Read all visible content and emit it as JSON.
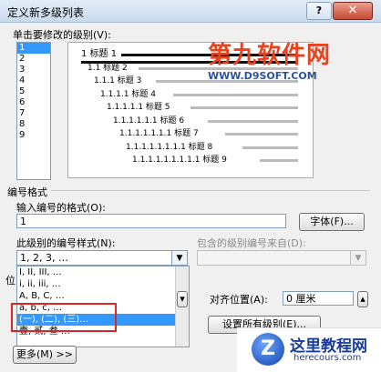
{
  "window": {
    "title": "定义新多级列表",
    "close_glyph": "✕",
    "help_glyph": "?"
  },
  "level_section": {
    "label": "单击要修改的级别(V):",
    "levels": [
      "1",
      "2",
      "3",
      "4",
      "5",
      "6",
      "7",
      "8",
      "9"
    ],
    "selected_index": 0
  },
  "preview": {
    "rows": [
      {
        "num": "1",
        "text": "标题 1"
      },
      {
        "num": "1.1",
        "text": "标题 2"
      },
      {
        "num": "1.1.1",
        "text": "标题 3"
      },
      {
        "num": "1.1.1.1",
        "text": "标题 4"
      },
      {
        "num": "1.1.1.1.1",
        "text": "标题 5"
      },
      {
        "num": "1.1.1.1.1.1",
        "text": "标题 6"
      },
      {
        "num": "1.1.1.1.1.1.1",
        "text": "标题 7"
      },
      {
        "num": "1.1.1.1.1.1.1.1",
        "text": "标题 8"
      },
      {
        "num": "1.1.1.1.1.1.1.1.1",
        "text": "标题 9"
      }
    ]
  },
  "number_format": {
    "section_label": "编号格式",
    "input_label": "输入编号的格式(O):",
    "input_value": "1",
    "font_button": "字体(F)...",
    "style_label": "此级别的编号样式(N):",
    "style_value": "1, 2, 3, …",
    "include_label": "包含的级别编号来自(D):",
    "style_options": [
      "I, II, III, …",
      "i, ii, iii, …",
      "A, B, C, …",
      "a, b, c, …",
      "(一), (二), (三)…",
      "壹, 贰, 叁 …"
    ],
    "highlighted_option": 4
  },
  "position": {
    "section_label": "位",
    "align_label": "对齐位置(A):",
    "align_value": "0 厘米",
    "set_all_button": "设置所有级别(E)..."
  },
  "more_button": "更多(M) >>",
  "watermark_top": {
    "logo": "第九软件网",
    "url": "WWW.D9SOFT.COM"
  },
  "watermark_bottom": {
    "glyph": "Z",
    "title": "这里教程网",
    "url": "herecours.com"
  }
}
